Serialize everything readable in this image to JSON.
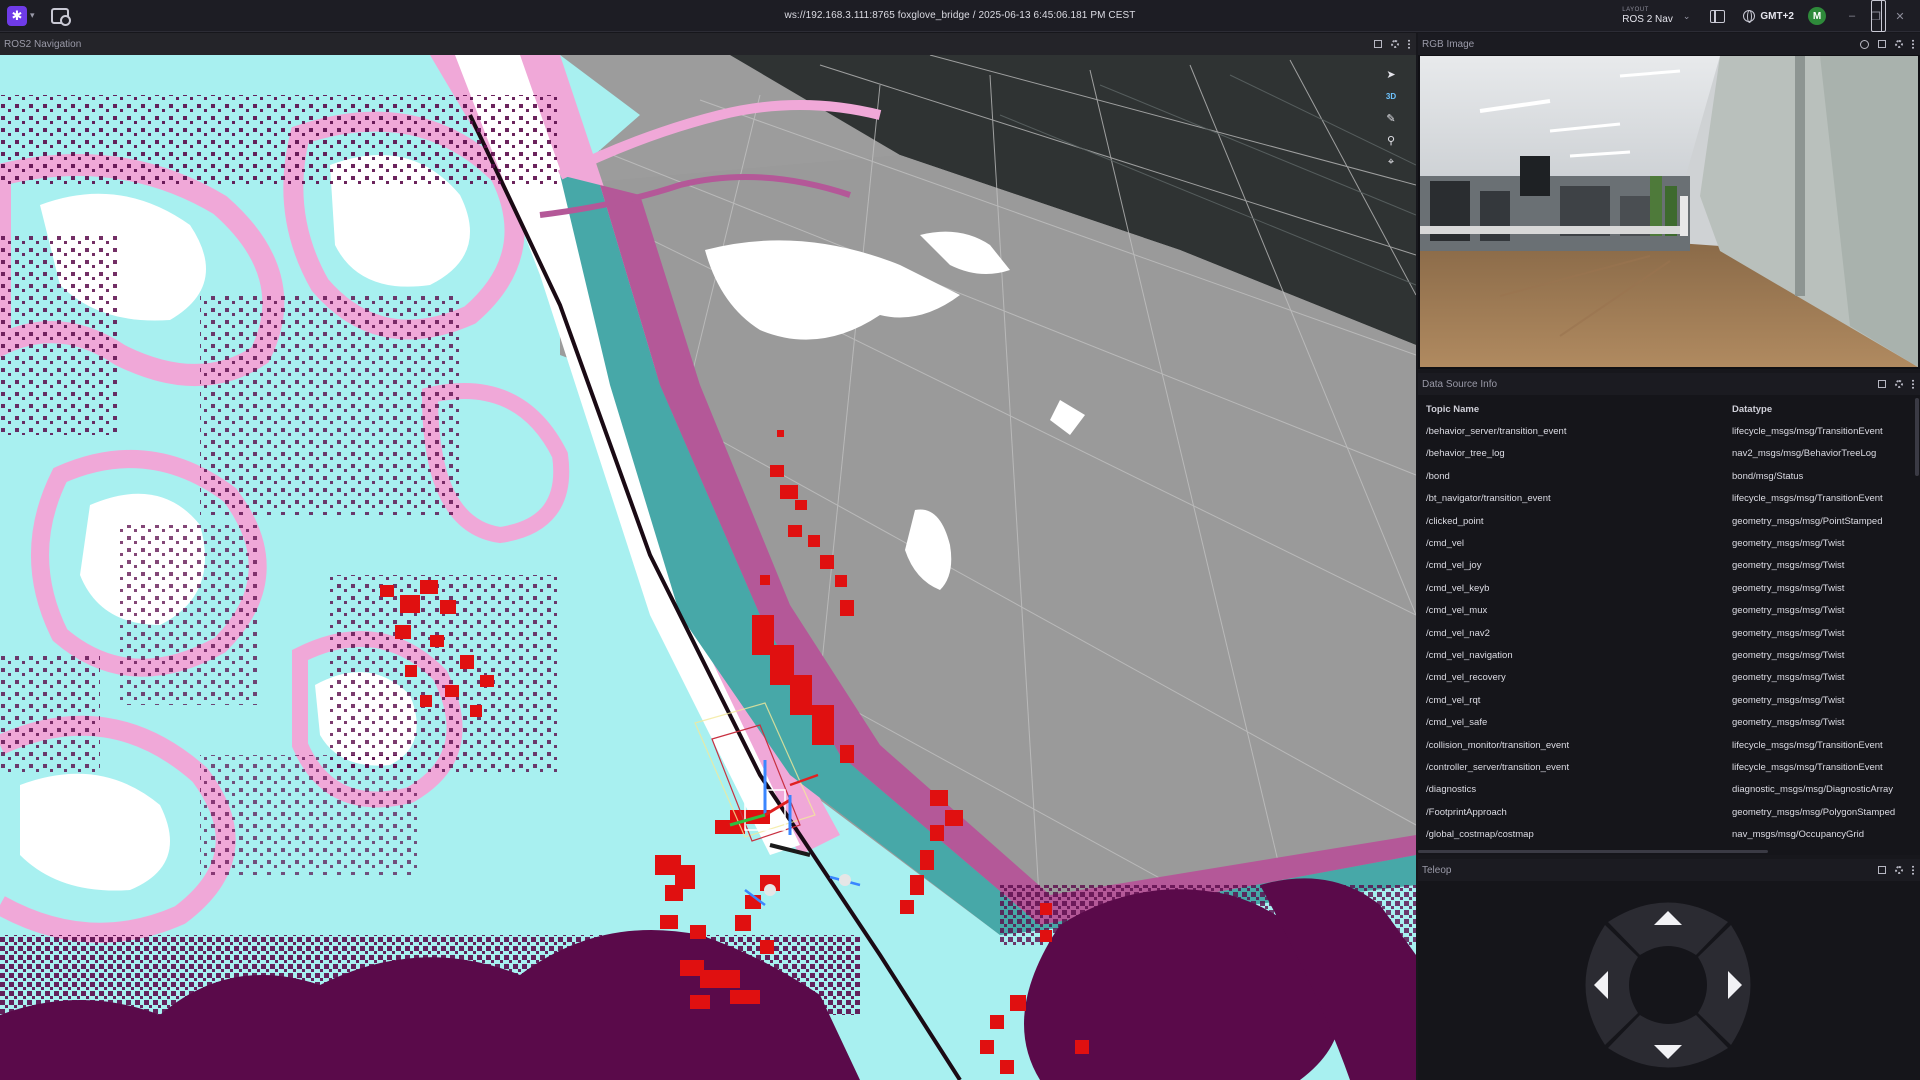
{
  "app": {
    "connection_title": "ws://192.168.3.111:8765 foxglove_bridge / 2025-06-13 6:45:06.181 PM CEST",
    "layout_label": "LAYOUT",
    "layout_name": "ROS 2 Nav",
    "timezone": "GMT+2",
    "user_initial": "M"
  },
  "panels": {
    "nav_title": "ROS2 Navigation",
    "view_mode": "3D",
    "rgb_title": "RGB Image",
    "datasource_title": "Data Source Info",
    "teleop_title": "Teleop"
  },
  "datasource": {
    "col_topic": "Topic Name",
    "col_type": "Datatype",
    "rows": [
      {
        "topic": "/behavior_server/transition_event",
        "type": "lifecycle_msgs/msg/TransitionEvent"
      },
      {
        "topic": "/behavior_tree_log",
        "type": "nav2_msgs/msg/BehaviorTreeLog"
      },
      {
        "topic": "/bond",
        "type": "bond/msg/Status"
      },
      {
        "topic": "/bt_navigator/transition_event",
        "type": "lifecycle_msgs/msg/TransitionEvent"
      },
      {
        "topic": "/clicked_point",
        "type": "geometry_msgs/msg/PointStamped"
      },
      {
        "topic": "/cmd_vel",
        "type": "geometry_msgs/msg/Twist"
      },
      {
        "topic": "/cmd_vel_joy",
        "type": "geometry_msgs/msg/Twist"
      },
      {
        "topic": "/cmd_vel_keyb",
        "type": "geometry_msgs/msg/Twist"
      },
      {
        "topic": "/cmd_vel_mux",
        "type": "geometry_msgs/msg/Twist"
      },
      {
        "topic": "/cmd_vel_nav2",
        "type": "geometry_msgs/msg/Twist"
      },
      {
        "topic": "/cmd_vel_navigation",
        "type": "geometry_msgs/msg/Twist"
      },
      {
        "topic": "/cmd_vel_recovery",
        "type": "geometry_msgs/msg/Twist"
      },
      {
        "topic": "/cmd_vel_rqt",
        "type": "geometry_msgs/msg/Twist"
      },
      {
        "topic": "/cmd_vel_safe",
        "type": "geometry_msgs/msg/Twist"
      },
      {
        "topic": "/collision_monitor/transition_event",
        "type": "lifecycle_msgs/msg/TransitionEvent"
      },
      {
        "topic": "/controller_server/transition_event",
        "type": "lifecycle_msgs/msg/TransitionEvent"
      },
      {
        "topic": "/diagnostics",
        "type": "diagnostic_msgs/msg/DiagnosticArray"
      },
      {
        "topic": "/FootprintApproach",
        "type": "geometry_msgs/msg/PolygonStamped"
      },
      {
        "topic": "/global_costmap/costmap",
        "type": "nav_msgs/msg/OccupancyGrid"
      }
    ]
  },
  "colors": {
    "accent": "#6f3be8",
    "costmap_free": "#a8f0f0",
    "costmap_inflated": "#f0a8d8",
    "costmap_lethal": "#5a0a4a",
    "obstacle_points": "#e01010",
    "map_gray": "#9a9a9a"
  },
  "icons": {
    "app_logo": "foxglove-logo-icon",
    "connection": "connection-icon",
    "left_sidebar": "left-sidebar-icon",
    "right_sidebar": "right-sidebar-icon",
    "timezone": "globe-icon"
  }
}
